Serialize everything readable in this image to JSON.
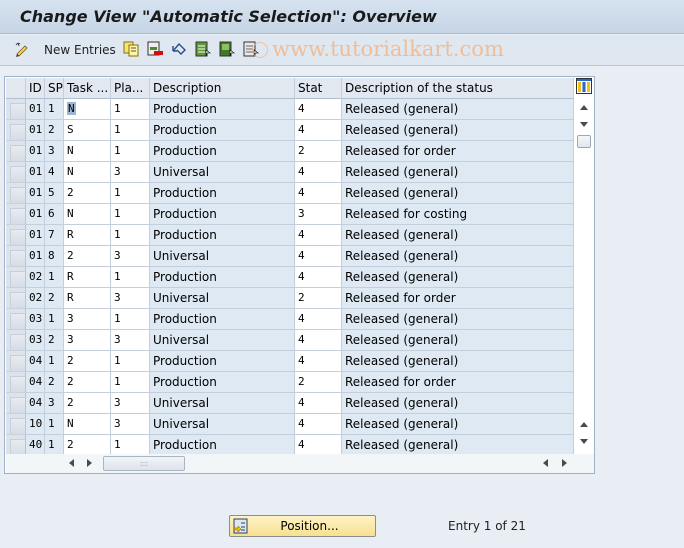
{
  "window": {
    "title": "Change View \"Automatic Selection\": Overview"
  },
  "toolbar": {
    "items": [
      {
        "icon": "edit-pencil-icon"
      },
      {
        "label": "New Entries"
      },
      {
        "icon": "copy-as-icon"
      },
      {
        "icon": "delete-icon"
      },
      {
        "icon": "undo-change-icon"
      },
      {
        "icon": "select-all-icon"
      },
      {
        "icon": "select-block-icon"
      },
      {
        "icon": "deselect-all-icon"
      }
    ],
    "new_entries_label": "New Entries",
    "watermark": "www.tutorialkart.com"
  },
  "table": {
    "columns": [
      "ID",
      "SP",
      "Task ...",
      "Pla...",
      "Description",
      "Stat",
      "Description of the status"
    ],
    "rows": [
      {
        "id": "01",
        "sp": "1",
        "task": "N",
        "pla": "1",
        "desc": "Production",
        "stat": "4",
        "sdesc": "Released (general)"
      },
      {
        "id": "01",
        "sp": "2",
        "task": "S",
        "pla": "1",
        "desc": "Production",
        "stat": "4",
        "sdesc": "Released (general)"
      },
      {
        "id": "01",
        "sp": "3",
        "task": "N",
        "pla": "1",
        "desc": "Production",
        "stat": "2",
        "sdesc": "Released for order"
      },
      {
        "id": "01",
        "sp": "4",
        "task": "N",
        "pla": "3",
        "desc": "Universal",
        "stat": "4",
        "sdesc": "Released (general)"
      },
      {
        "id": "01",
        "sp": "5",
        "task": "2",
        "pla": "1",
        "desc": "Production",
        "stat": "4",
        "sdesc": "Released (general)"
      },
      {
        "id": "01",
        "sp": "6",
        "task": "N",
        "pla": "1",
        "desc": "Production",
        "stat": "3",
        "sdesc": "Released for costing"
      },
      {
        "id": "01",
        "sp": "7",
        "task": "R",
        "pla": "1",
        "desc": "Production",
        "stat": "4",
        "sdesc": "Released (general)"
      },
      {
        "id": "01",
        "sp": "8",
        "task": "2",
        "pla": "3",
        "desc": "Universal",
        "stat": "4",
        "sdesc": "Released (general)"
      },
      {
        "id": "02",
        "sp": "1",
        "task": "R",
        "pla": "1",
        "desc": "Production",
        "stat": "4",
        "sdesc": "Released (general)"
      },
      {
        "id": "02",
        "sp": "2",
        "task": "R",
        "pla": "3",
        "desc": "Universal",
        "stat": "2",
        "sdesc": "Released for order"
      },
      {
        "id": "03",
        "sp": "1",
        "task": "3",
        "pla": "1",
        "desc": "Production",
        "stat": "4",
        "sdesc": "Released (general)"
      },
      {
        "id": "03",
        "sp": "2",
        "task": "3",
        "pla": "3",
        "desc": "Universal",
        "stat": "4",
        "sdesc": "Released (general)"
      },
      {
        "id": "04",
        "sp": "1",
        "task": "2",
        "pla": "1",
        "desc": "Production",
        "stat": "4",
        "sdesc": "Released (general)"
      },
      {
        "id": "04",
        "sp": "2",
        "task": "2",
        "pla": "1",
        "desc": "Production",
        "stat": "2",
        "sdesc": "Released for order"
      },
      {
        "id": "04",
        "sp": "3",
        "task": "2",
        "pla": "3",
        "desc": "Universal",
        "stat": "4",
        "sdesc": "Released (general)"
      },
      {
        "id": "10",
        "sp": "1",
        "task": "N",
        "pla": "3",
        "desc": "Universal",
        "stat": "4",
        "sdesc": "Released (general)"
      },
      {
        "id": "40",
        "sp": "1",
        "task": "2",
        "pla": "1",
        "desc": "Production",
        "stat": "4",
        "sdesc": "Released (general)"
      }
    ]
  },
  "footer": {
    "position_button": "Position...",
    "entry_status": "Entry 1 of 21"
  }
}
